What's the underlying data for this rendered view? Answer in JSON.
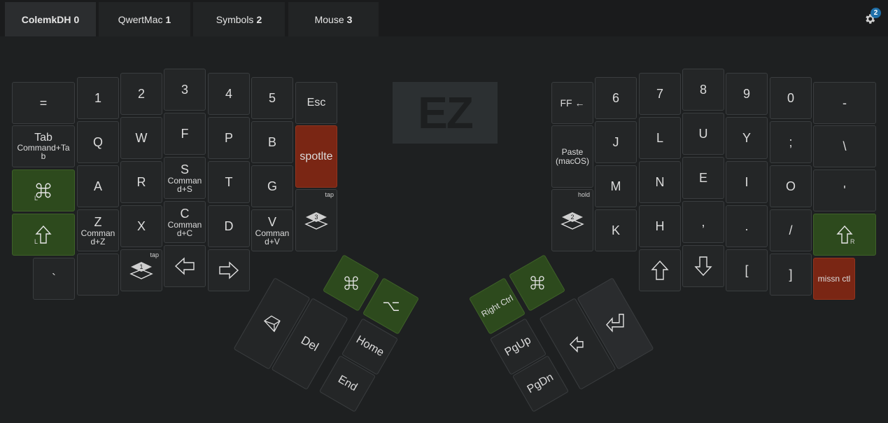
{
  "tabs": [
    {
      "label": "ColemkDH",
      "num": "0"
    },
    {
      "label": "QwertMac",
      "num": "1"
    },
    {
      "label": "Symbols",
      "num": "2"
    },
    {
      "label": "Mouse",
      "num": "3"
    }
  ],
  "settings_badge": "2",
  "logo_text": "EZ",
  "left": {
    "r1": [
      "=",
      "1",
      "2",
      "3",
      "4",
      "5",
      "Esc"
    ],
    "tab": {
      "main": "Tab",
      "sub": "Command+Ta b"
    },
    "r2": [
      "Q",
      "W",
      "F",
      "P",
      "B"
    ],
    "spot": "spotlte",
    "r3": [
      "A",
      "R"
    ],
    "s": {
      "main": "S",
      "sub": "Comman d+S"
    },
    "r3b": [
      "T",
      "G"
    ],
    "z": {
      "main": "Z",
      "sub": "Comman d+Z"
    },
    "x": "X",
    "c": {
      "main": "C",
      "sub": "Comman d+C"
    },
    "d": "D",
    "v": {
      "main": "V",
      "sub": "Comman d+V"
    },
    "backtick": "`",
    "layer1": "1",
    "layer3": "3",
    "tap": "tap",
    "mod_l": "L",
    "th_del": "Del",
    "th_home": "Home",
    "th_end": "End"
  },
  "right": {
    "ff": "FF ←",
    "r1": [
      "6",
      "7",
      "8",
      "9",
      "0",
      "-"
    ],
    "paste": "Paste (macOS)",
    "r2": [
      "J",
      "L",
      "U",
      "Y",
      ";",
      "\\"
    ],
    "r3": [
      "M",
      "N",
      "E",
      "I",
      "O",
      "'"
    ],
    "r4": [
      "K",
      "H",
      ",",
      ".",
      "/"
    ],
    "layer2": "2",
    "hold": "hold",
    "bot": [
      "[",
      "]"
    ],
    "missn": "missn ctl",
    "mod_r": "R",
    "th_rctrl": "Right Ctrl",
    "th_pgup": "PgUp",
    "th_pgdn": "PgDn"
  }
}
